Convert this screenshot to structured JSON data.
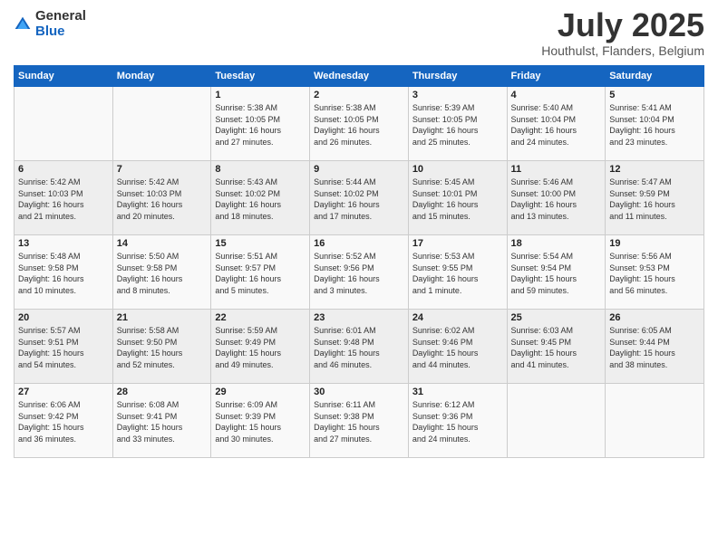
{
  "logo": {
    "general": "General",
    "blue": "Blue"
  },
  "title": "July 2025",
  "location": "Houthulst, Flanders, Belgium",
  "days_of_week": [
    "Sunday",
    "Monday",
    "Tuesday",
    "Wednesday",
    "Thursday",
    "Friday",
    "Saturday"
  ],
  "weeks": [
    [
      {
        "day": "",
        "info": ""
      },
      {
        "day": "",
        "info": ""
      },
      {
        "day": "1",
        "info": "Sunrise: 5:38 AM\nSunset: 10:05 PM\nDaylight: 16 hours\nand 27 minutes."
      },
      {
        "day": "2",
        "info": "Sunrise: 5:38 AM\nSunset: 10:05 PM\nDaylight: 16 hours\nand 26 minutes."
      },
      {
        "day": "3",
        "info": "Sunrise: 5:39 AM\nSunset: 10:05 PM\nDaylight: 16 hours\nand 25 minutes."
      },
      {
        "day": "4",
        "info": "Sunrise: 5:40 AM\nSunset: 10:04 PM\nDaylight: 16 hours\nand 24 minutes."
      },
      {
        "day": "5",
        "info": "Sunrise: 5:41 AM\nSunset: 10:04 PM\nDaylight: 16 hours\nand 23 minutes."
      }
    ],
    [
      {
        "day": "6",
        "info": "Sunrise: 5:42 AM\nSunset: 10:03 PM\nDaylight: 16 hours\nand 21 minutes."
      },
      {
        "day": "7",
        "info": "Sunrise: 5:42 AM\nSunset: 10:03 PM\nDaylight: 16 hours\nand 20 minutes."
      },
      {
        "day": "8",
        "info": "Sunrise: 5:43 AM\nSunset: 10:02 PM\nDaylight: 16 hours\nand 18 minutes."
      },
      {
        "day": "9",
        "info": "Sunrise: 5:44 AM\nSunset: 10:02 PM\nDaylight: 16 hours\nand 17 minutes."
      },
      {
        "day": "10",
        "info": "Sunrise: 5:45 AM\nSunset: 10:01 PM\nDaylight: 16 hours\nand 15 minutes."
      },
      {
        "day": "11",
        "info": "Sunrise: 5:46 AM\nSunset: 10:00 PM\nDaylight: 16 hours\nand 13 minutes."
      },
      {
        "day": "12",
        "info": "Sunrise: 5:47 AM\nSunset: 9:59 PM\nDaylight: 16 hours\nand 11 minutes."
      }
    ],
    [
      {
        "day": "13",
        "info": "Sunrise: 5:48 AM\nSunset: 9:58 PM\nDaylight: 16 hours\nand 10 minutes."
      },
      {
        "day": "14",
        "info": "Sunrise: 5:50 AM\nSunset: 9:58 PM\nDaylight: 16 hours\nand 8 minutes."
      },
      {
        "day": "15",
        "info": "Sunrise: 5:51 AM\nSunset: 9:57 PM\nDaylight: 16 hours\nand 5 minutes."
      },
      {
        "day": "16",
        "info": "Sunrise: 5:52 AM\nSunset: 9:56 PM\nDaylight: 16 hours\nand 3 minutes."
      },
      {
        "day": "17",
        "info": "Sunrise: 5:53 AM\nSunset: 9:55 PM\nDaylight: 16 hours\nand 1 minute."
      },
      {
        "day": "18",
        "info": "Sunrise: 5:54 AM\nSunset: 9:54 PM\nDaylight: 15 hours\nand 59 minutes."
      },
      {
        "day": "19",
        "info": "Sunrise: 5:56 AM\nSunset: 9:53 PM\nDaylight: 15 hours\nand 56 minutes."
      }
    ],
    [
      {
        "day": "20",
        "info": "Sunrise: 5:57 AM\nSunset: 9:51 PM\nDaylight: 15 hours\nand 54 minutes."
      },
      {
        "day": "21",
        "info": "Sunrise: 5:58 AM\nSunset: 9:50 PM\nDaylight: 15 hours\nand 52 minutes."
      },
      {
        "day": "22",
        "info": "Sunrise: 5:59 AM\nSunset: 9:49 PM\nDaylight: 15 hours\nand 49 minutes."
      },
      {
        "day": "23",
        "info": "Sunrise: 6:01 AM\nSunset: 9:48 PM\nDaylight: 15 hours\nand 46 minutes."
      },
      {
        "day": "24",
        "info": "Sunrise: 6:02 AM\nSunset: 9:46 PM\nDaylight: 15 hours\nand 44 minutes."
      },
      {
        "day": "25",
        "info": "Sunrise: 6:03 AM\nSunset: 9:45 PM\nDaylight: 15 hours\nand 41 minutes."
      },
      {
        "day": "26",
        "info": "Sunrise: 6:05 AM\nSunset: 9:44 PM\nDaylight: 15 hours\nand 38 minutes."
      }
    ],
    [
      {
        "day": "27",
        "info": "Sunrise: 6:06 AM\nSunset: 9:42 PM\nDaylight: 15 hours\nand 36 minutes."
      },
      {
        "day": "28",
        "info": "Sunrise: 6:08 AM\nSunset: 9:41 PM\nDaylight: 15 hours\nand 33 minutes."
      },
      {
        "day": "29",
        "info": "Sunrise: 6:09 AM\nSunset: 9:39 PM\nDaylight: 15 hours\nand 30 minutes."
      },
      {
        "day": "30",
        "info": "Sunrise: 6:11 AM\nSunset: 9:38 PM\nDaylight: 15 hours\nand 27 minutes."
      },
      {
        "day": "31",
        "info": "Sunrise: 6:12 AM\nSunset: 9:36 PM\nDaylight: 15 hours\nand 24 minutes."
      },
      {
        "day": "",
        "info": ""
      },
      {
        "day": "",
        "info": ""
      }
    ]
  ]
}
